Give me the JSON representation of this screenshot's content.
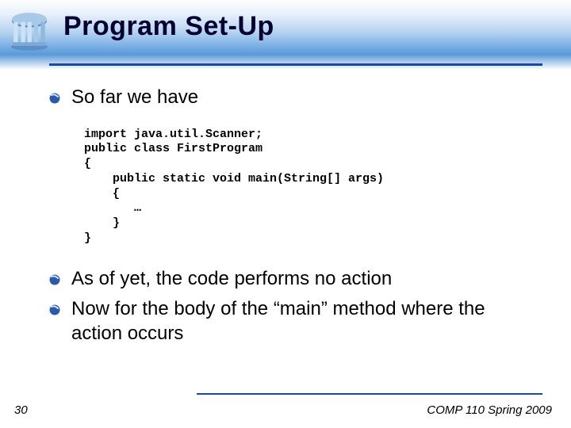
{
  "title": "Program Set-Up",
  "bullets": {
    "b1": "So far we have",
    "b2": "As of yet, the code performs no action",
    "b3": "Now for the body of the “main” method where the action occurs"
  },
  "code": "import java.util.Scanner;\npublic class FirstProgram\n{\n    public static void main(String[] args)\n    {\n       …\n    }\n}",
  "footer": {
    "slide_number": "30",
    "course": "COMP 110 Spring 2009"
  }
}
